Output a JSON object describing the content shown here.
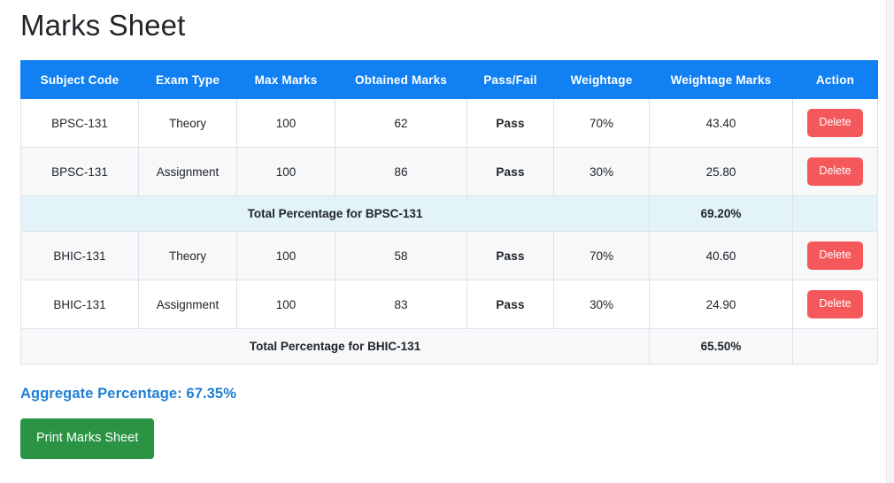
{
  "page": {
    "title": "Marks Sheet"
  },
  "table": {
    "headers": [
      "Subject Code",
      "Exam Type",
      "Max Marks",
      "Obtained Marks",
      "Pass/Fail",
      "Weightage",
      "Weightage Marks",
      "Action"
    ],
    "header_bg": "#1180f2",
    "header_text_color": "#ffffff",
    "rows": [
      {
        "kind": "data",
        "subject_code": "BPSC-131",
        "exam_type": "Theory",
        "max_marks": "100",
        "obtained_marks": "62",
        "pass_fail": "Pass",
        "weightage": "70%",
        "weightage_marks": "43.40",
        "action_label": "Delete"
      },
      {
        "kind": "data",
        "subject_code": "BPSC-131",
        "exam_type": "Assignment",
        "max_marks": "100",
        "obtained_marks": "86",
        "pass_fail": "Pass",
        "weightage": "30%",
        "weightage_marks": "25.80",
        "action_label": "Delete"
      },
      {
        "kind": "total",
        "label": "Total Percentage for BPSC-131",
        "value": "69.20%",
        "bg": "#e2f4f9"
      },
      {
        "kind": "data",
        "subject_code": "BHIC-131",
        "exam_type": "Theory",
        "max_marks": "100",
        "obtained_marks": "58",
        "pass_fail": "Pass",
        "weightage": "70%",
        "weightage_marks": "40.60",
        "action_label": "Delete"
      },
      {
        "kind": "data",
        "subject_code": "BHIC-131",
        "exam_type": "Assignment",
        "max_marks": "100",
        "obtained_marks": "83",
        "pass_fail": "Pass",
        "weightage": "30%",
        "weightage_marks": "24.90",
        "action_label": "Delete"
      },
      {
        "kind": "total",
        "label": "Total Percentage for BHIC-131",
        "value": "65.50%",
        "bg": "#f7f8f9"
      }
    ]
  },
  "footer": {
    "aggregate_text": "Aggregate Percentage: 67.35%",
    "aggregate_color": "#1f7fd4",
    "print_label": "Print Marks Sheet",
    "print_color": "#2a9444"
  }
}
